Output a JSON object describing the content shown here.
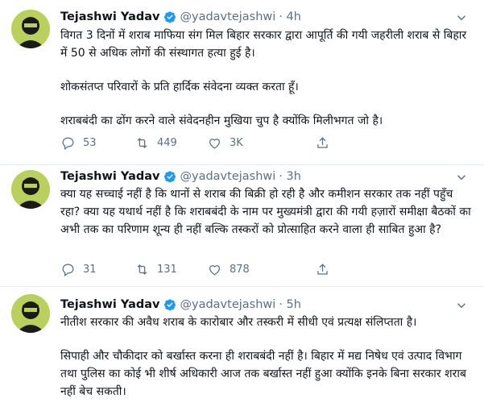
{
  "colors": {
    "text": "#0f1419",
    "secondary": "#5b7083",
    "verified": "#1d9bf0",
    "divider": "#e6ecf0",
    "avatar_bg": "#b9d15c"
  },
  "tweets": [
    {
      "name": "Tejashwi Yadav",
      "handle": "@yadavtejashwi",
      "time": "· 4h",
      "paragraphs": [
        "विगत 3 दिनों में शराब माफिया संग मिल बिहार सरकार द्वारा आपूर्ति की गयी जहरीली शराब से बिहार में 50 से अधिक लोगों की संस्थागत हत्या हुई है।",
        "शोकसंतप्त परिवारों के प्रति हार्दिक संवेदना व्यक्त करता हूँ।",
        "शराबबंदी का ढोंग करने वाले संवेदनहीन मुखिया चुप है क्योंकि मिलीभगत जो है।"
      ],
      "replies": "53",
      "retweets": "449",
      "likes": "3K"
    },
    {
      "name": "Tejashwi Yadav",
      "handle": "@yadavtejashwi",
      "time": "· 3h",
      "paragraphs": [
        "क्या यह सच्चाई नहीं है कि थानों से शराब की बिक्री हो रही है और कमीशन सरकार तक नहीं पहुँच रहा? क्या यह यथार्थ नहीं है कि शराबबंदी के नाम पर मुख्यमंत्री द्वारा की गयी हज़ारों समीक्षा बैठकों का अभी तक का परिणाम शून्य ही नहीं बल्कि तस्करों को प्रोत्साहित करने वाला ही साबित हुआ है?"
      ],
      "replies": "31",
      "retweets": "131",
      "likes": "878"
    },
    {
      "name": "Tejashwi Yadav",
      "handle": "@yadavtejashwi",
      "time": "· 5h",
      "paragraphs": [
        "नीतीश सरकार की अवैध शराब के कारोबार और तस्करी में सीधी एवं प्रत्यक्ष संलिप्तता है।",
        "सिपाही और चौकीदार को बर्खास्त करना ही शराबबंदी नहीं है। बिहार में मद्य निषेध एवं उत्पाद विभाग तथा पुलिस का कोई भी शीर्ष अधिकारी आज तक बर्खास्त नहीं हुआ क्योंकि इनके बिना सरकार शराब नहीं बेच सकती।"
      ]
    }
  ]
}
